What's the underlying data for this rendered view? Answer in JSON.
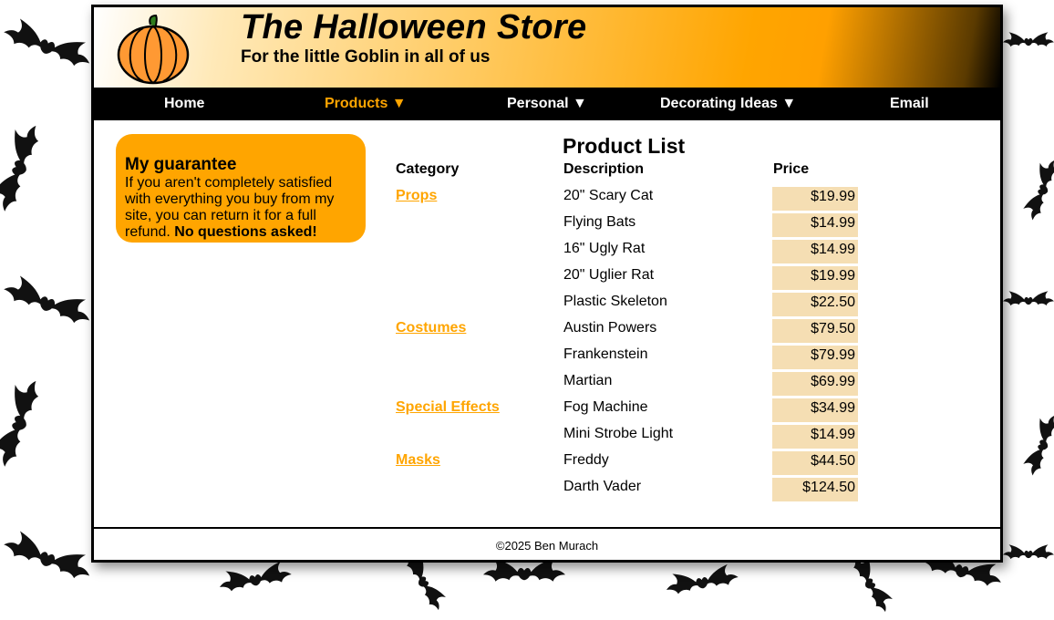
{
  "header": {
    "title": "The Halloween Store",
    "tagline": "For the little Goblin in all of us"
  },
  "icons": {
    "logo": "pumpkin-icon",
    "background": "bat-icon"
  },
  "colors": {
    "accent": "#ffa500",
    "price_bg": "#f5deb3",
    "nav_bg": "#000000"
  },
  "nav": [
    {
      "label": "Home"
    },
    {
      "label": "Products ▼"
    },
    {
      "label": "Personal ▼"
    },
    {
      "label": "Decorating Ideas ▼"
    },
    {
      "label": "Email"
    }
  ],
  "guarantee": {
    "heading": "My guarantee",
    "text": "If you aren't completely satisfied with everything you buy from my site, you can return it for a full refund.",
    "emphasis": "No questions asked!"
  },
  "product_list": {
    "title": "Product List",
    "headers": {
      "category": "Category",
      "description": "Description",
      "price": "Price"
    },
    "categories": [
      "Props",
      "Costumes",
      "Special Effects",
      "Masks"
    ],
    "rows": [
      {
        "description": "20\" Scary Cat",
        "price": "$19.99"
      },
      {
        "description": "Flying Bats",
        "price": "$14.99"
      },
      {
        "description": "16\" Ugly Rat",
        "price": "$14.99"
      },
      {
        "description": "20\" Uglier Rat",
        "price": "$19.99"
      },
      {
        "description": "Plastic Skeleton",
        "price": "$22.50"
      },
      {
        "description": "Austin Powers",
        "price": "$79.50"
      },
      {
        "description": "Frankenstein",
        "price": "$79.99"
      },
      {
        "description": "Martian",
        "price": "$69.99"
      },
      {
        "description": "Fog Machine",
        "price": "$34.99"
      },
      {
        "description": "Mini Strobe Light",
        "price": "$14.99"
      },
      {
        "description": "Freddy",
        "price": "$44.50"
      },
      {
        "description": "Darth Vader",
        "price": "$124.50"
      }
    ]
  },
  "footer": {
    "copyright": "©2025 Ben Murach"
  }
}
